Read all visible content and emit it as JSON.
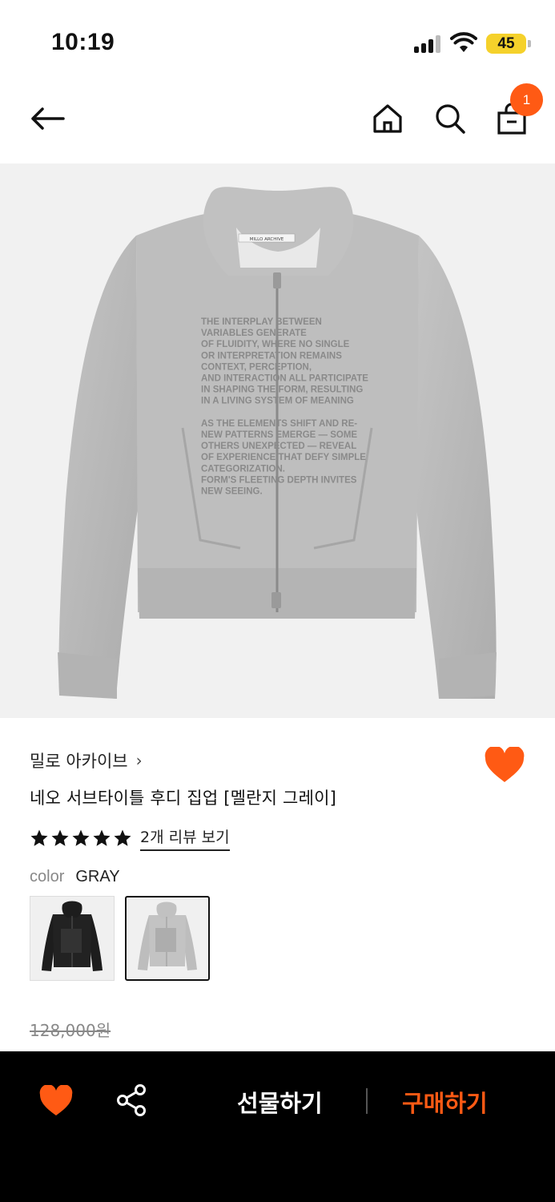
{
  "status_bar": {
    "time": "10:19",
    "battery": "45"
  },
  "nav": {
    "cart_count": "1",
    "accent_color": "#ff5a14"
  },
  "product": {
    "brand": "밀로 아카이브",
    "brand_chevron": "›",
    "title": "네오 서브타이틀 후디 집업 [멜란지 그레이]",
    "rating": 5,
    "rating_max": 5,
    "review_link": "2개 리뷰 보기",
    "color_label": "color",
    "color_value": "GRAY",
    "original_price": "128,000원",
    "print_lines": [
      "THE INTERPLAY BETWEEN",
      "VARIABLES GENERATE",
      "OF FLUIDITY, WHERE NO SINGLE",
      "OR INTERPRETATION REMAINS",
      "CONTEXT, PERCEPTION,",
      "AND INTERACTION ALL PARTICIPATE",
      "IN SHAPING THE FORM, RESULTING",
      "IN A LIVING SYSTEM OF MEANING",
      "",
      "AS THE ELEMENTS SHIFT AND RE-",
      "NEW PATTERNS EMERGE — SOME",
      "OTHERS UNEXPECTED — REVEAL",
      "OF EXPERIENCE THAT DEFY SIMPLE",
      "CATEGORIZATION.",
      "FORM'S FLEETING DEPTH INVITES",
      "NEW SEEING."
    ],
    "neck_label": "MILLO ARCHIVE"
  },
  "swatches": [
    {
      "name": "black",
      "color": "#1d1d1d"
    },
    {
      "name": "gray",
      "color": "#bdbdbd"
    }
  ],
  "bottom_bar": {
    "gift_label": "선물하기",
    "buy_label": "구매하기"
  }
}
